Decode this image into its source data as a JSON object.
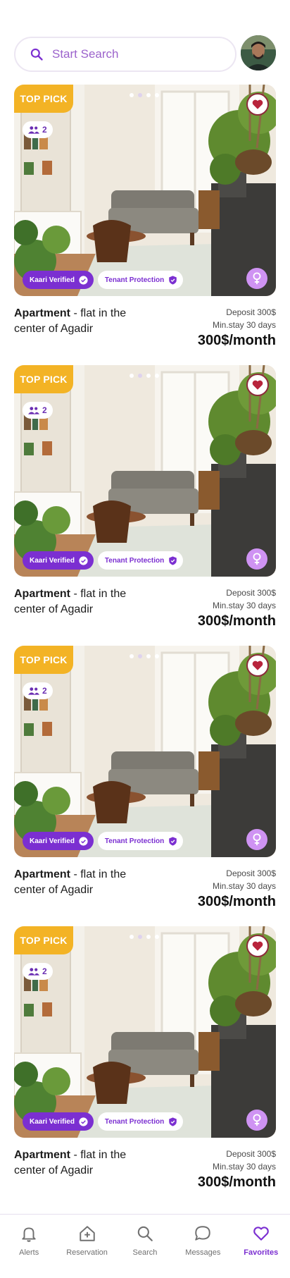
{
  "search": {
    "placeholder": "Start Search"
  },
  "listings": [
    {
      "badge": "TOP PICK",
      "guests": "2",
      "verified_label": "Kaari Verified",
      "protection_label": "Tenant Protection",
      "type": "Apartment",
      "title_rest": " - flat in the center of Agadir",
      "deposit": "Deposit 300$",
      "min_stay": "Min.stay 30 days",
      "price": "300$/month"
    },
    {
      "badge": "TOP PICK",
      "guests": "2",
      "verified_label": "Kaari Verified",
      "protection_label": "Tenant Protection",
      "type": "Apartment",
      "title_rest": " - flat in the center of Agadir",
      "deposit": "Deposit 300$",
      "min_stay": "Min.stay 30 days",
      "price": "300$/month"
    },
    {
      "badge": "TOP PICK",
      "guests": "2",
      "verified_label": "Kaari Verified",
      "protection_label": "Tenant Protection",
      "type": "Apartment",
      "title_rest": " - flat in the center of Agadir",
      "deposit": "Deposit 300$",
      "min_stay": "Min.stay 30 days",
      "price": "300$/month"
    },
    {
      "badge": "TOP PICK",
      "guests": "2",
      "verified_label": "Kaari Verified",
      "protection_label": "Tenant Protection",
      "type": "Apartment",
      "title_rest": " - flat in the center of Agadir",
      "deposit": "Deposit 300$",
      "min_stay": "Min.stay 30 days",
      "price": "300$/month"
    }
  ],
  "nav": [
    {
      "label": "Alerts",
      "icon": "bell-icon"
    },
    {
      "label": "Reservation",
      "icon": "home-plus-icon"
    },
    {
      "label": "Search",
      "icon": "search-icon"
    },
    {
      "label": "Messages",
      "icon": "chat-bubble-icon"
    },
    {
      "label": "Favorites",
      "icon": "heart-icon",
      "active": true
    }
  ],
  "colors": {
    "accent": "#7b2fd1",
    "top_pick": "#f3b325",
    "gender_badge": "#cf93f3",
    "favorite_heart": "#b8243c"
  }
}
